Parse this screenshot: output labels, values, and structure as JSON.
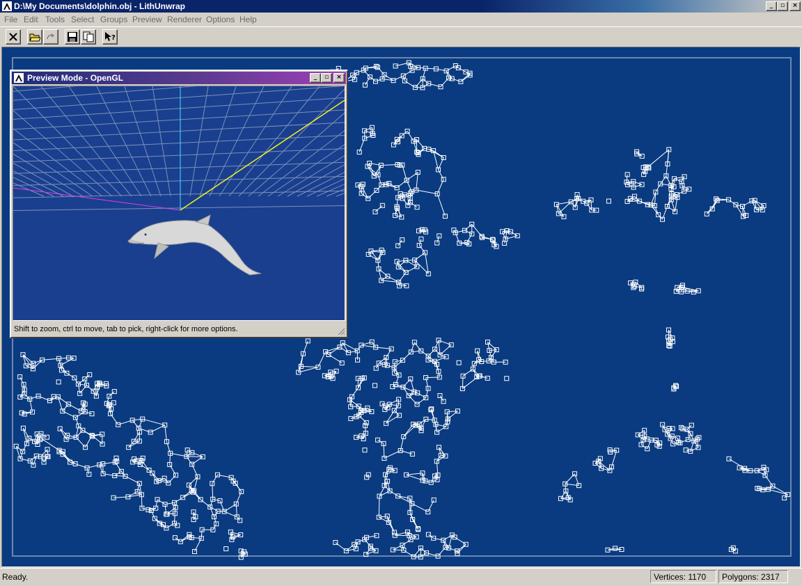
{
  "window": {
    "title": "D:\\My Documents\\dolphin.obj - LithUnwrap",
    "controls": {
      "minimize": "_",
      "maximize": "▫",
      "close": "×"
    }
  },
  "menu": [
    "File",
    "Edit",
    "Tools",
    "Select",
    "Groups",
    "Preview",
    "Renderer",
    "Options",
    "Help"
  ],
  "toolbar": {
    "buttons": [
      "close-icon",
      "open-folder-icon",
      "redo-icon",
      "save-icon",
      "copy-icon",
      "context-help-icon"
    ]
  },
  "preview": {
    "title": "Preview Mode - OpenGL",
    "hint": "Shift to zoom, ctrl to move, tab to pick, right-click for more options."
  },
  "status": {
    "text": "Ready.",
    "vertices": "Vertices: 1170",
    "polygons": "Polygons: 2317"
  },
  "colors": {
    "title_active": "#0a246a",
    "canvas": "#0a3b80",
    "wireframe": "#ffffff"
  }
}
